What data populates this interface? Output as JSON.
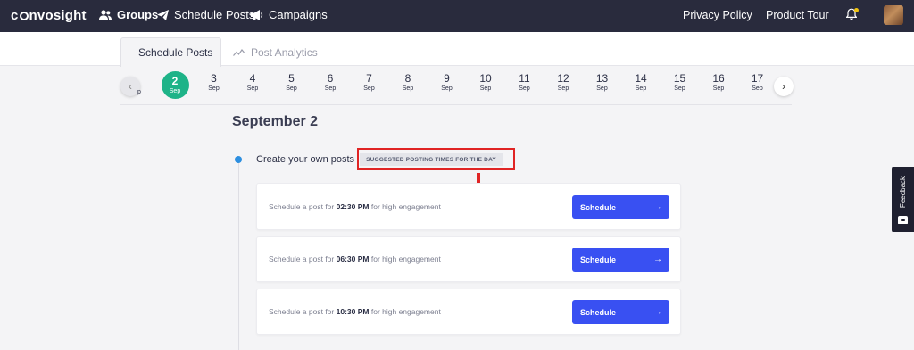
{
  "header": {
    "logo": {
      "prefix": "c",
      "suffix": "nvosight"
    },
    "nav": [
      {
        "label": "Groups",
        "icon": "users-icon"
      },
      {
        "label": "Schedule Posts",
        "icon": "paper-plane-icon"
      },
      {
        "label": "Campaigns",
        "icon": "megaphone-icon"
      }
    ],
    "privacy_label": "Privacy Policy",
    "tour_label": "Product Tour"
  },
  "tabs": [
    {
      "label": "Schedule Posts",
      "icon": "paper-plane-icon",
      "active": true
    },
    {
      "label": "Post Analytics",
      "icon": "trend-line-icon",
      "active": false
    }
  ],
  "date_strip": {
    "partial_left": "p",
    "dates": [
      {
        "day": "2",
        "month": "Sep",
        "selected": true
      },
      {
        "day": "3",
        "month": "Sep"
      },
      {
        "day": "4",
        "month": "Sep"
      },
      {
        "day": "5",
        "month": "Sep"
      },
      {
        "day": "6",
        "month": "Sep"
      },
      {
        "day": "7",
        "month": "Sep"
      },
      {
        "day": "8",
        "month": "Sep"
      },
      {
        "day": "9",
        "month": "Sep"
      },
      {
        "day": "10",
        "month": "Sep"
      },
      {
        "day": "11",
        "month": "Sep"
      },
      {
        "day": "12",
        "month": "Sep"
      },
      {
        "day": "13",
        "month": "Sep"
      },
      {
        "day": "14",
        "month": "Sep"
      },
      {
        "day": "15",
        "month": "Sep"
      },
      {
        "day": "16",
        "month": "Sep"
      },
      {
        "day": "17",
        "month": "Sep"
      }
    ]
  },
  "main": {
    "day_heading": "September 2",
    "create_label": "Create your own posts",
    "suggested_badge": "SUGGESTED POSTING TIMES FOR THE DAY",
    "slots": [
      {
        "prefix": "Schedule a post for",
        "time": "02:30 PM",
        "suffix": "for high engagement",
        "button": "Schedule"
      },
      {
        "prefix": "Schedule a post for",
        "time": "06:30 PM",
        "suffix": "for high engagement",
        "button": "Schedule"
      },
      {
        "prefix": "Schedule a post for",
        "time": "10:30 PM",
        "suffix": "for high engagement",
        "button": "Schedule"
      }
    ]
  },
  "feedback_label": "Feedback",
  "colors": {
    "navbar": "#292b3d",
    "selected_date": "#1eb388",
    "schedule_button": "#3950f2",
    "highlight_box": "#e02424",
    "timeline_dot": "#2d8fe0"
  }
}
